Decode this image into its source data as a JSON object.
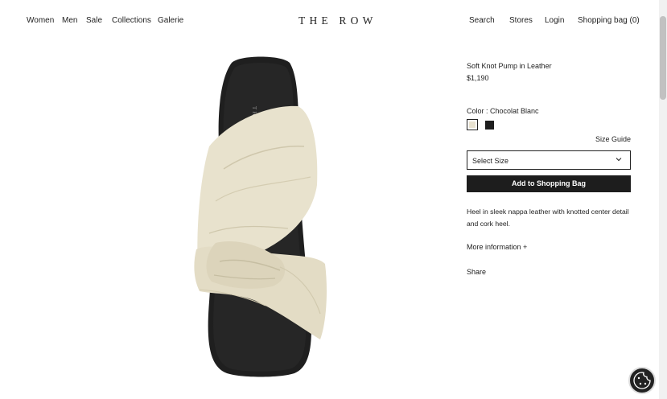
{
  "nav": {
    "left": [
      "Women",
      "Men",
      "Sale",
      "Collections",
      "Galerie"
    ],
    "logo": "THE ROW",
    "right": [
      "Search",
      "Stores",
      "Login",
      "Shopping bag (0)"
    ]
  },
  "product": {
    "title": "Soft Knot Pump in Leather",
    "price": "$1,190",
    "color_label": "Color : Chocolat Blanc",
    "swatches": [
      {
        "name": "Chocolat Blanc",
        "color": "#e7e1cf",
        "selected": true
      },
      {
        "name": "Black",
        "color": "#1e1e1e",
        "selected": false
      }
    ],
    "size_guide": "Size Guide",
    "select_size": "Select Size",
    "add_to_bag": "Add to Shopping Bag",
    "description": "Heel in sleek nappa leather with knotted center detail and cork heel.",
    "more_info": "More information +",
    "share": "Share",
    "insole_brand": "THE ROW"
  },
  "colors": {
    "leather": "#e8e2cd",
    "sole": "#1f1f1f",
    "button": "#1d1d1d"
  }
}
